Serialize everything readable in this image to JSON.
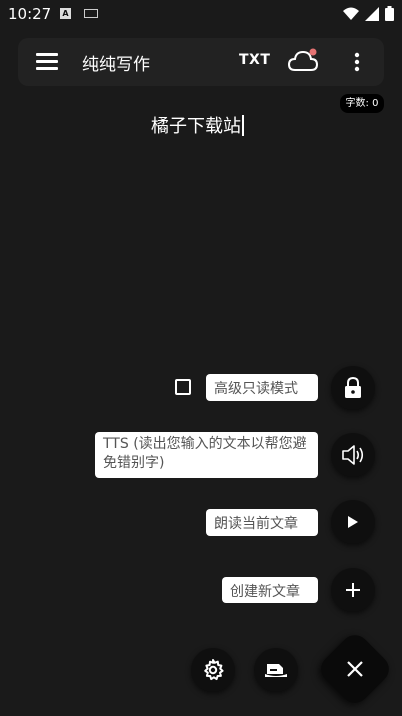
{
  "status_bar": {
    "time": "10:27",
    "notification_icon_letter": "A",
    "icons": [
      "wifi-icon",
      "signal-icon",
      "battery-icon"
    ]
  },
  "toolbar": {
    "menu_icon": "hamburger-menu-icon",
    "title": "纯纯写作",
    "txt_label": "TXT",
    "cloud_icon": "cloud-sync-icon",
    "cloud_badge_color": "#e57373",
    "more_icon": "more-vert-icon"
  },
  "editor": {
    "word_count_label": "字数: 0",
    "text": "橘子下载站"
  },
  "actions": {
    "readonly_label": "高级只读模式",
    "readonly_checked": false,
    "tts_label": "TTS (读出您输入的文本以帮您避免错别字)",
    "read_current_label": "朗读当前文章",
    "new_article_label": "创建新文章"
  },
  "bottom": {
    "settings_icon": "gear-icon",
    "theme_icon": "sandbox-icon",
    "close_icon": "close-icon"
  },
  "colors": {
    "background": "#1a1a1a",
    "toolbar": "#222222",
    "fab": "#0f0f0f",
    "label_bg": "#ffffff",
    "label_text": "#555555"
  }
}
